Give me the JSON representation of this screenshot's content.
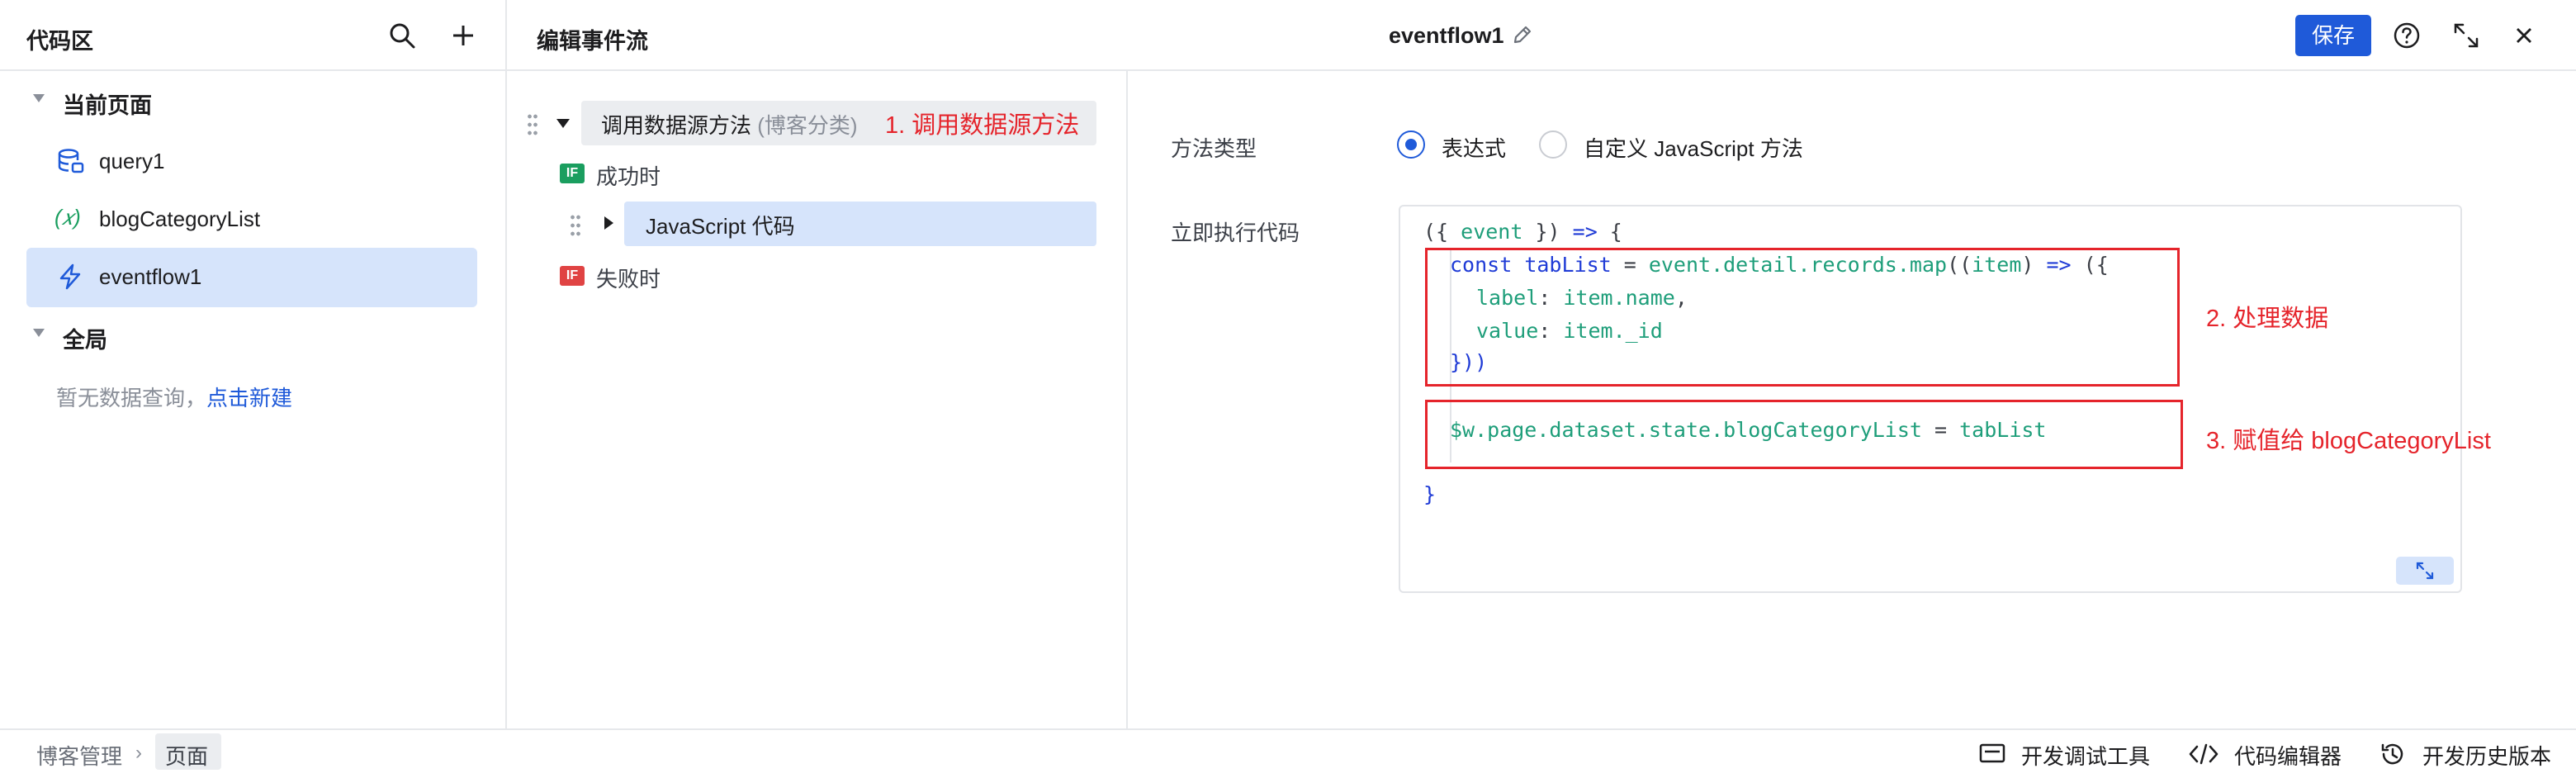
{
  "left_panel": {
    "title": "代码区",
    "sections": [
      {
        "label": "当前页面",
        "items": [
          {
            "label": "query1",
            "icon": "database-icon"
          },
          {
            "label": "blogCategoryList",
            "icon": "variable-icon"
          },
          {
            "label": "eventflow1",
            "icon": "lightning-icon",
            "selected": true
          }
        ]
      },
      {
        "label": "全局",
        "empty_text": "暂无数据查询，",
        "empty_link": "点击新建"
      }
    ]
  },
  "topbar": {
    "title": "编辑事件流",
    "flow_name": "eventflow1",
    "save_label": "保存"
  },
  "flow": {
    "main_node": "调用数据源方法",
    "main_node_category": "(博客分类)",
    "success_badge": "IF",
    "success_label": "成功时",
    "js_node": "JavaScript 代码",
    "fail_badge": "IF",
    "fail_label": "失败时"
  },
  "annotations": {
    "step1": "1. 调用数据源方法",
    "step2": "2. 处理数据",
    "step3": "3. 赋值给 blogCategoryList"
  },
  "form": {
    "method_type_label": "方法类型",
    "option_expression": "表达式",
    "option_custom_js": "自定义 JavaScript 方法",
    "selected_option": "表达式",
    "run_code_label": "立即执行代码"
  },
  "code": {
    "l1_a": "({ ",
    "l1_b": "event",
    "l1_c": " }) ",
    "l1_d": "=>",
    "l1_e": " {",
    "l2_a": "const ",
    "l2_b": "tabList",
    "l2_c": " = ",
    "l2_d": "event.detail.records.map",
    "l2_e": "((",
    "l2_f": "item",
    "l2_g": ") ",
    "l2_h": "=>",
    "l2_i": " ({",
    "l3_a": "label",
    "l3_b": ": ",
    "l3_c": "item.name",
    "l3_d": ",",
    "l4_a": "value",
    "l4_b": ": ",
    "l4_c": "item._id",
    "l5": "}))",
    "l6_a": "$w.page.dataset.state.blogCategoryList",
    "l6_b": " = ",
    "l6_c": "tabList",
    "l7": "}"
  },
  "bottombar": {
    "breadcrumb": [
      "博客管理",
      "页面"
    ],
    "debug_tool": "开发调试工具",
    "code_editor": "代码编辑器",
    "history": "开发历史版本"
  },
  "colors": {
    "accent": "#1f5ad9",
    "selected_bg": "#d6e4fb",
    "annotation_red": "#e5242b",
    "success_green": "#1a9e5f",
    "fail_red": "#e04343"
  }
}
